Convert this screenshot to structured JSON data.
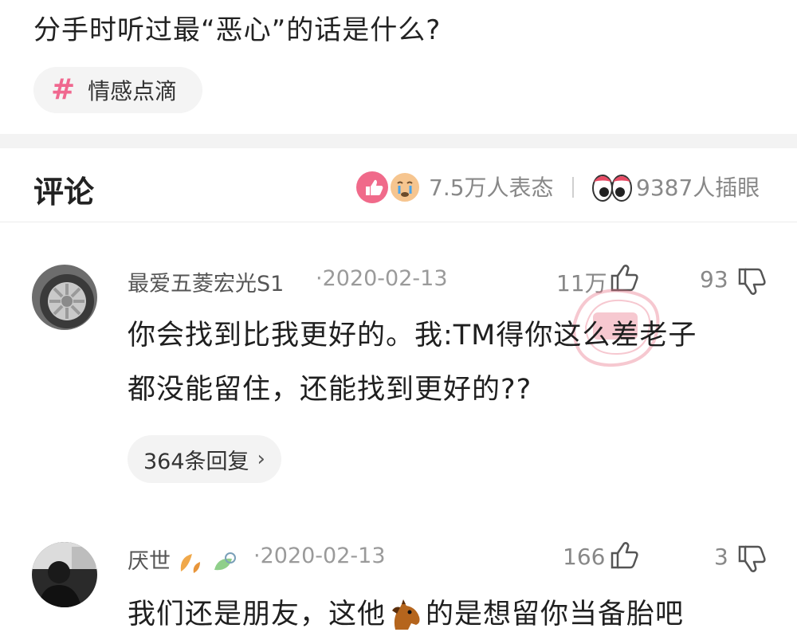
{
  "post": {
    "title": "分手时听过最“恶心”的话是什么?",
    "tag": {
      "label": "情感点滴",
      "icon": "hash-icon"
    }
  },
  "comments_section": {
    "title": "评论",
    "reaction_count": "7.5万人表态",
    "eye_count": "9387人插眼"
  },
  "comments": [
    {
      "username": "最爱五菱宏光S1",
      "date": "·2020-02-13",
      "likes": "11万",
      "dislikes": "93",
      "text_line1": "你会找到比我更好的。我:TM得你这么差老子",
      "text_line2": "都没能留住，还能找到更好的??",
      "replies": "364条回复",
      "avatar": "car-wheel-avatar"
    },
    {
      "username": "厌世",
      "date": "·2020-02-13",
      "likes": "166",
      "dislikes": "3",
      "text_part1": "我们还是朋友，这他",
      "text_part2": "的是想留你当备胎吧",
      "avatar": "person-dark-avatar"
    }
  ],
  "colors": {
    "accent": "#f0688f",
    "stamp": "#e8647c",
    "muted": "#888888"
  }
}
